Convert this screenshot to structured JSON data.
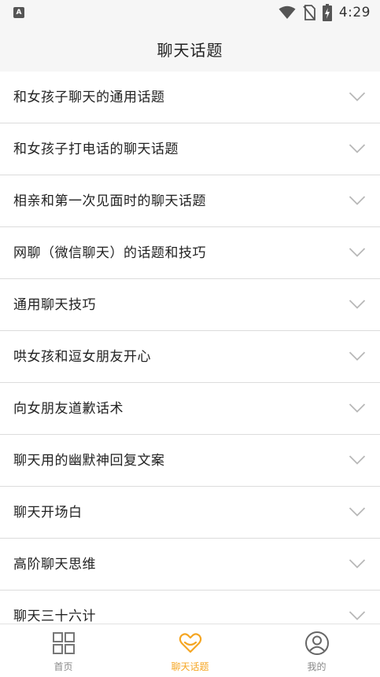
{
  "status_bar": {
    "notification_icon": "A",
    "time": "4:29",
    "icons": [
      "wifi-icon",
      "no-sim-icon",
      "battery-charging-icon"
    ]
  },
  "header": {
    "title": "聊天话题"
  },
  "topics": [
    {
      "label": "和女孩子聊天的通用话题"
    },
    {
      "label": "和女孩子打电话的聊天话题"
    },
    {
      "label": "相亲和第一次见面时的聊天话题"
    },
    {
      "label": "网聊（微信聊天）的话题和技巧"
    },
    {
      "label": "通用聊天技巧"
    },
    {
      "label": "哄女孩和逗女朋友开心"
    },
    {
      "label": "向女朋友道歉话术"
    },
    {
      "label": "聊天用的幽默神回复文案"
    },
    {
      "label": "聊天开场白"
    },
    {
      "label": "高阶聊天思维"
    },
    {
      "label": "聊天三十六计"
    }
  ],
  "tab_bar": {
    "tabs": [
      {
        "label": "首页",
        "icon": "grid-icon",
        "active": false
      },
      {
        "label": "聊天话题",
        "icon": "heart-chat-icon",
        "active": true
      },
      {
        "label": "我的",
        "icon": "user-icon",
        "active": false
      }
    ]
  },
  "colors": {
    "accent": "#f5a623",
    "inactive": "#888888",
    "header_bg": "#f6f6f6",
    "divider": "#dcdcdc"
  }
}
